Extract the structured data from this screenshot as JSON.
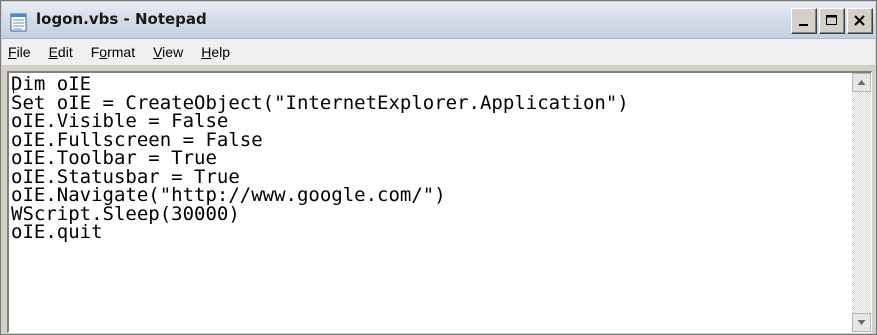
{
  "window": {
    "title": "logon.vbs - Notepad",
    "controls": [
      "minimize-icon",
      "maximize-icon",
      "close-icon"
    ]
  },
  "menu": [
    {
      "accel": "F",
      "rest": "ile"
    },
    {
      "accel": "E",
      "rest": "dit"
    },
    {
      "pre": "F",
      "accel": "o",
      "rest": "rmat"
    },
    {
      "accel": "V",
      "rest": "iew"
    },
    {
      "accel": "H",
      "rest": "elp"
    }
  ],
  "editor": {
    "lines": [
      "Dim oIE",
      "Set oIE = CreateObject(\"InternetExplorer.Application\")",
      "oIE.Visible = False",
      "oIE.Fullscreen = False",
      "oIE.Toolbar = True",
      "oIE.Statusbar = True",
      "oIE.Navigate(\"http://www.google.com/\")",
      "WScript.Sleep(30000)",
      "oIE.quit"
    ]
  },
  "icons": {
    "app": "notepad-icon",
    "scroll_up": "arrow-up-icon",
    "scroll_down": "arrow-down-icon"
  }
}
